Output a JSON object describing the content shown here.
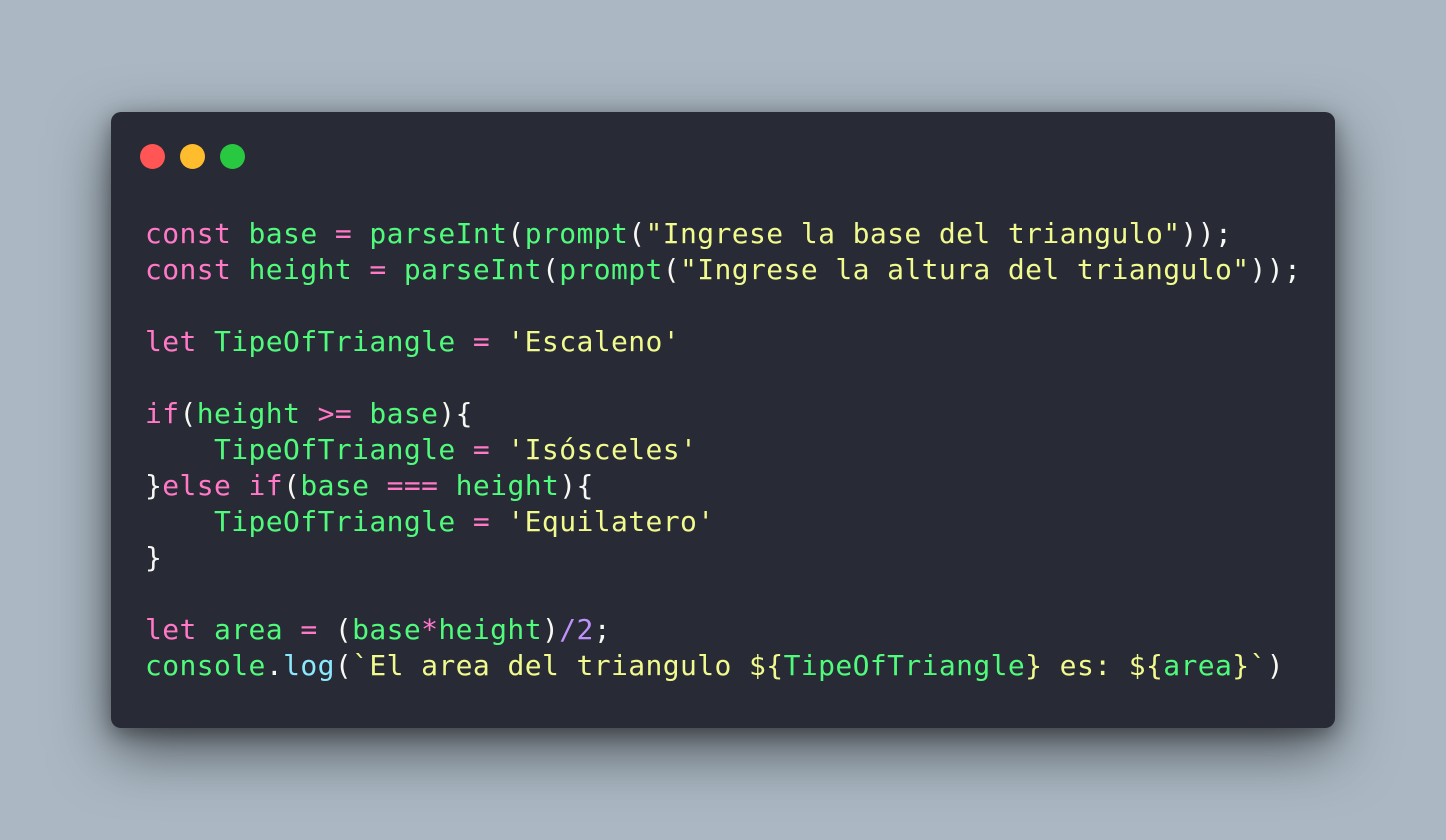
{
  "window": {
    "controls": [
      "close",
      "minimize",
      "maximize"
    ],
    "colors": {
      "close": "#ff5555",
      "minimize": "#ffbd2e",
      "maximize": "#28c940",
      "background": "#282a36",
      "page_background": "#abb8c3"
    }
  },
  "code": {
    "language": "javascript",
    "lines": [
      [
        {
          "t": "kw",
          "v": "const "
        },
        {
          "t": "fn",
          "v": "base"
        },
        {
          "t": "kw",
          "v": " = "
        },
        {
          "t": "fn",
          "v": "parseInt"
        },
        {
          "t": "plain",
          "v": "("
        },
        {
          "t": "fn",
          "v": "prompt"
        },
        {
          "t": "plain",
          "v": "("
        },
        {
          "t": "str",
          "v": "\"Ingrese la base del triangulo\""
        },
        {
          "t": "plain",
          "v": "));"
        }
      ],
      [
        {
          "t": "kw",
          "v": "const "
        },
        {
          "t": "fn",
          "v": "height"
        },
        {
          "t": "kw",
          "v": " = "
        },
        {
          "t": "fn",
          "v": "parseInt"
        },
        {
          "t": "plain",
          "v": "("
        },
        {
          "t": "fn",
          "v": "prompt"
        },
        {
          "t": "plain",
          "v": "("
        },
        {
          "t": "str",
          "v": "\"Ingrese la altura del triangulo\""
        },
        {
          "t": "plain",
          "v": "));"
        }
      ],
      [],
      [
        {
          "t": "kw",
          "v": "let "
        },
        {
          "t": "fn",
          "v": "TipeOfTriangle"
        },
        {
          "t": "kw",
          "v": " = "
        },
        {
          "t": "str",
          "v": "'Escaleno'"
        }
      ],
      [],
      [
        {
          "t": "kw",
          "v": "if"
        },
        {
          "t": "plain",
          "v": "("
        },
        {
          "t": "fn",
          "v": "height"
        },
        {
          "t": "kw",
          "v": " >= "
        },
        {
          "t": "fn",
          "v": "base"
        },
        {
          "t": "plain",
          "v": "){"
        }
      ],
      [
        {
          "t": "plain",
          "v": "    "
        },
        {
          "t": "fn",
          "v": "TipeOfTriangle"
        },
        {
          "t": "kw",
          "v": " = "
        },
        {
          "t": "str",
          "v": "'Isósceles'"
        }
      ],
      [
        {
          "t": "plain",
          "v": "}"
        },
        {
          "t": "kw",
          "v": "else if"
        },
        {
          "t": "plain",
          "v": "("
        },
        {
          "t": "fn",
          "v": "base"
        },
        {
          "t": "kw",
          "v": " === "
        },
        {
          "t": "fn",
          "v": "height"
        },
        {
          "t": "plain",
          "v": "){"
        }
      ],
      [
        {
          "t": "plain",
          "v": "    "
        },
        {
          "t": "fn",
          "v": "TipeOfTriangle"
        },
        {
          "t": "kw",
          "v": " = "
        },
        {
          "t": "str",
          "v": "'Equilatero'"
        }
      ],
      [
        {
          "t": "plain",
          "v": "}"
        }
      ],
      [],
      [
        {
          "t": "kw",
          "v": "let "
        },
        {
          "t": "fn",
          "v": "area"
        },
        {
          "t": "kw",
          "v": " = "
        },
        {
          "t": "plain",
          "v": "("
        },
        {
          "t": "fn",
          "v": "base"
        },
        {
          "t": "kw",
          "v": "*"
        },
        {
          "t": "fn",
          "v": "height"
        },
        {
          "t": "plain",
          "v": ")"
        },
        {
          "t": "num",
          "v": "/"
        },
        {
          "t": "num",
          "v": "2"
        },
        {
          "t": "plain",
          "v": ";"
        }
      ],
      [
        {
          "t": "fn",
          "v": "console"
        },
        {
          "t": "plain",
          "v": "."
        },
        {
          "t": "method",
          "v": "log"
        },
        {
          "t": "plain",
          "v": "("
        },
        {
          "t": "str",
          "v": "`El area del triangulo "
        },
        {
          "t": "str",
          "v": "${"
        },
        {
          "t": "fn",
          "v": "TipeOfTriangle"
        },
        {
          "t": "str",
          "v": "} es: "
        },
        {
          "t": "str",
          "v": "${"
        },
        {
          "t": "fn",
          "v": "area"
        },
        {
          "t": "str",
          "v": "}`"
        },
        {
          "t": "plain",
          "v": ")"
        }
      ]
    ]
  }
}
